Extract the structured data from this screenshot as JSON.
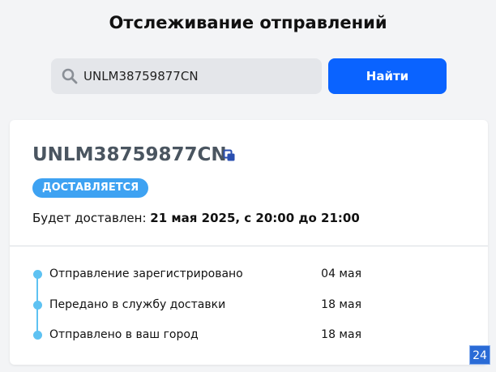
{
  "page": {
    "title": "Отслеживание отправлений"
  },
  "search": {
    "value": "UNLM38759877CN",
    "button_label": "Найти"
  },
  "shipment": {
    "tracking_number": "UNLM38759877CN",
    "status": "ДОСТАВЛЯЕТСЯ",
    "delivery_prefix": "Будет доставлен: ",
    "delivery_value": "21 мая 2025, с 20:00 до 21:00"
  },
  "events": [
    {
      "text": "Отправление зарегистрировано",
      "date": "04 мая"
    },
    {
      "text": "Передано в службу доставки",
      "date": "18 мая"
    },
    {
      "text": "Отправлено в ваш город",
      "date": "18 мая"
    }
  ],
  "corner_badge": "24",
  "colors": {
    "accent": "#0a63ff",
    "status": "#3ea2f2",
    "timeline": "#5ec2f2"
  }
}
